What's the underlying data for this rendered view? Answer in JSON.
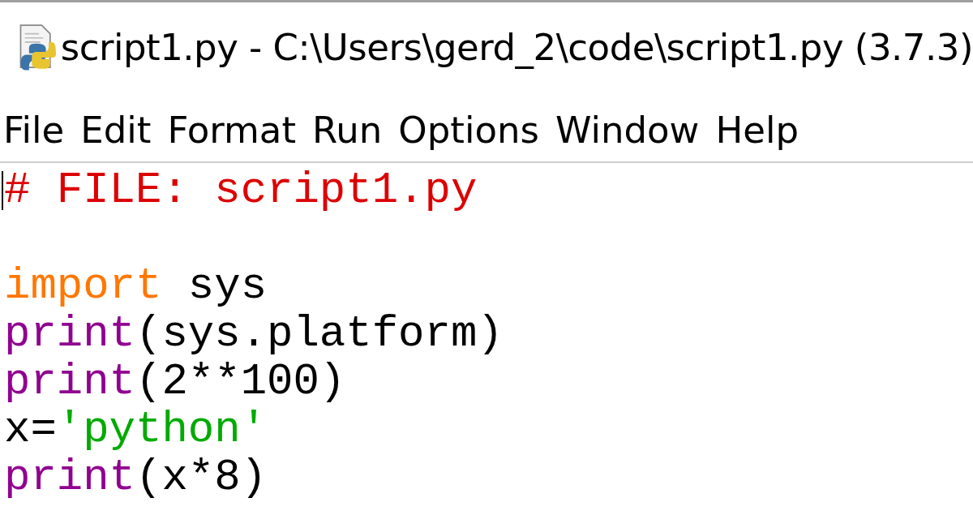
{
  "window": {
    "title": "script1.py - C:\\Users\\gerd_2\\code\\script1.py (3.7.3)"
  },
  "menu": [
    "File",
    "Edit",
    "Format",
    "Run",
    "Options",
    "Window",
    "Help"
  ],
  "editor": {
    "lines": [
      {
        "kind": "code",
        "cursor": true,
        "tokens": [
          {
            "kind": "comment",
            "text": "# FILE: script1.py"
          }
        ]
      },
      {
        "kind": "blank"
      },
      {
        "kind": "code",
        "cursor": false,
        "tokens": [
          {
            "kind": "keyword",
            "text": "import"
          },
          {
            "kind": "plain",
            "text": " sys"
          }
        ]
      },
      {
        "kind": "code",
        "cursor": false,
        "tokens": [
          {
            "kind": "builtin",
            "text": "print"
          },
          {
            "kind": "plain",
            "text": "(sys.platform)"
          }
        ]
      },
      {
        "kind": "code",
        "cursor": false,
        "tokens": [
          {
            "kind": "builtin",
            "text": "print"
          },
          {
            "kind": "plain",
            "text": "(2**100)"
          }
        ]
      },
      {
        "kind": "code",
        "cursor": false,
        "tokens": [
          {
            "kind": "plain",
            "text": "x="
          },
          {
            "kind": "string",
            "text": "'python'"
          }
        ]
      },
      {
        "kind": "code",
        "cursor": false,
        "tokens": [
          {
            "kind": "builtin",
            "text": "print"
          },
          {
            "kind": "plain",
            "text": "(x*8)"
          }
        ]
      }
    ]
  }
}
